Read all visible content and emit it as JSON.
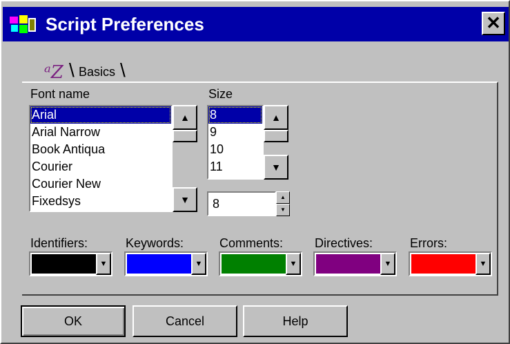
{
  "window": {
    "title": "Script Preferences",
    "close_label": "✕"
  },
  "tab": {
    "label": "Basics",
    "icon": "az-font-icon",
    "icon_glyph": "ᵃZ"
  },
  "font": {
    "label": "Font name",
    "items": [
      "Arial",
      "Arial Narrow",
      "Book Antiqua",
      "Courier",
      "Courier New",
      "Fixedsys"
    ],
    "selected": "Arial"
  },
  "size": {
    "label": "Size",
    "items": [
      "8",
      "9",
      "10",
      "11"
    ],
    "selected": "8",
    "value": "8"
  },
  "colors": [
    {
      "label": "Identifiers:",
      "color": "#000000"
    },
    {
      "label": "Keywords:",
      "color": "#0000ff"
    },
    {
      "label": "Comments:",
      "color": "#008000"
    },
    {
      "label": "Directives:",
      "color": "#800080"
    },
    {
      "label": "Errors:",
      "color": "#ff0000"
    }
  ],
  "buttons": {
    "ok": "OK",
    "cancel": "Cancel",
    "help": "Help"
  }
}
